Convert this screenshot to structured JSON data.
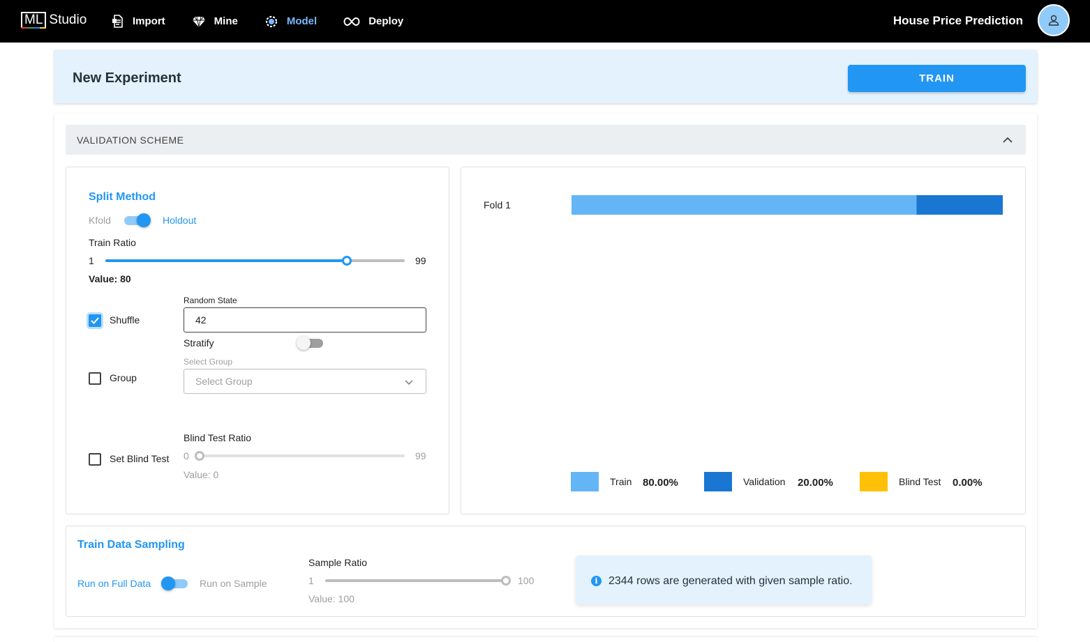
{
  "nav": {
    "logo_box": "ML",
    "logo_text": "Studio",
    "items": [
      {
        "label": "Import",
        "icon": "document-icon"
      },
      {
        "label": "Mine",
        "icon": "diamond-icon"
      },
      {
        "label": "Model",
        "icon": "gear-brain-icon"
      },
      {
        "label": "Deploy",
        "icon": "infinity-icon"
      }
    ],
    "active_item": "Model",
    "project_title": "House Price Prediction",
    "avatar_icon": "user-icon"
  },
  "experiment": {
    "title": "New Experiment",
    "train_label": "TRAIN"
  },
  "validation": {
    "header": "VALIDATION SCHEME",
    "split_method": {
      "title": "Split Method",
      "left_option": "Kfold",
      "right_option": "Holdout",
      "selected": "Holdout"
    },
    "train_ratio": {
      "label": "Train Ratio",
      "min": "1",
      "max": "99",
      "value": 80,
      "value_text": "Value: 80"
    },
    "shuffle": {
      "label": "Shuffle",
      "checked": true,
      "random_state_label": "Random State",
      "random_state_value": "42",
      "stratify_label": "Stratify",
      "stratify_on": false
    },
    "group": {
      "label": "Group",
      "checked": false,
      "select_label": "Select Group",
      "select_placeholder": "Select Group"
    },
    "blind_test": {
      "label": "Set Blind Test",
      "checked": false,
      "ratio_label": "Blind Test Ratio",
      "min": "0",
      "max": "99",
      "value": 0,
      "value_text": "Value: 0"
    }
  },
  "chart_data": {
    "type": "bar",
    "orientation": "horizontal-stacked",
    "categories": [
      "Fold 1"
    ],
    "series": [
      {
        "name": "Train",
        "values": [
          80
        ],
        "color": "#64b5f6"
      },
      {
        "name": "Validation",
        "values": [
          20
        ],
        "color": "#1976d2"
      },
      {
        "name": "Blind Test",
        "values": [
          0
        ],
        "color": "#ffc107"
      }
    ],
    "xlim": [
      0,
      100
    ],
    "legend_placement": "bottom",
    "legend": [
      {
        "name": "Train",
        "percent": "80.00%",
        "color": "#64b5f6"
      },
      {
        "name": "Validation",
        "percent": "20.00%",
        "color": "#1976d2"
      },
      {
        "name": "Blind Test",
        "percent": "0.00%",
        "color": "#ffc107"
      }
    ]
  },
  "sampling": {
    "title": "Train Data Sampling",
    "left_option": "Run on Full Data",
    "right_option": "Run on Sample",
    "selected": "Run on Full Data",
    "ratio_label": "Sample Ratio",
    "min": "1",
    "max": "100",
    "value": 100,
    "value_text": "Value: 100",
    "info": "2344 rows are generated with given sample ratio.",
    "info_icon": "info-icon"
  },
  "colors": {
    "accent": "#2196f3",
    "nav_active": "#7ab8ff",
    "header_bg": "#e3f2fd"
  }
}
